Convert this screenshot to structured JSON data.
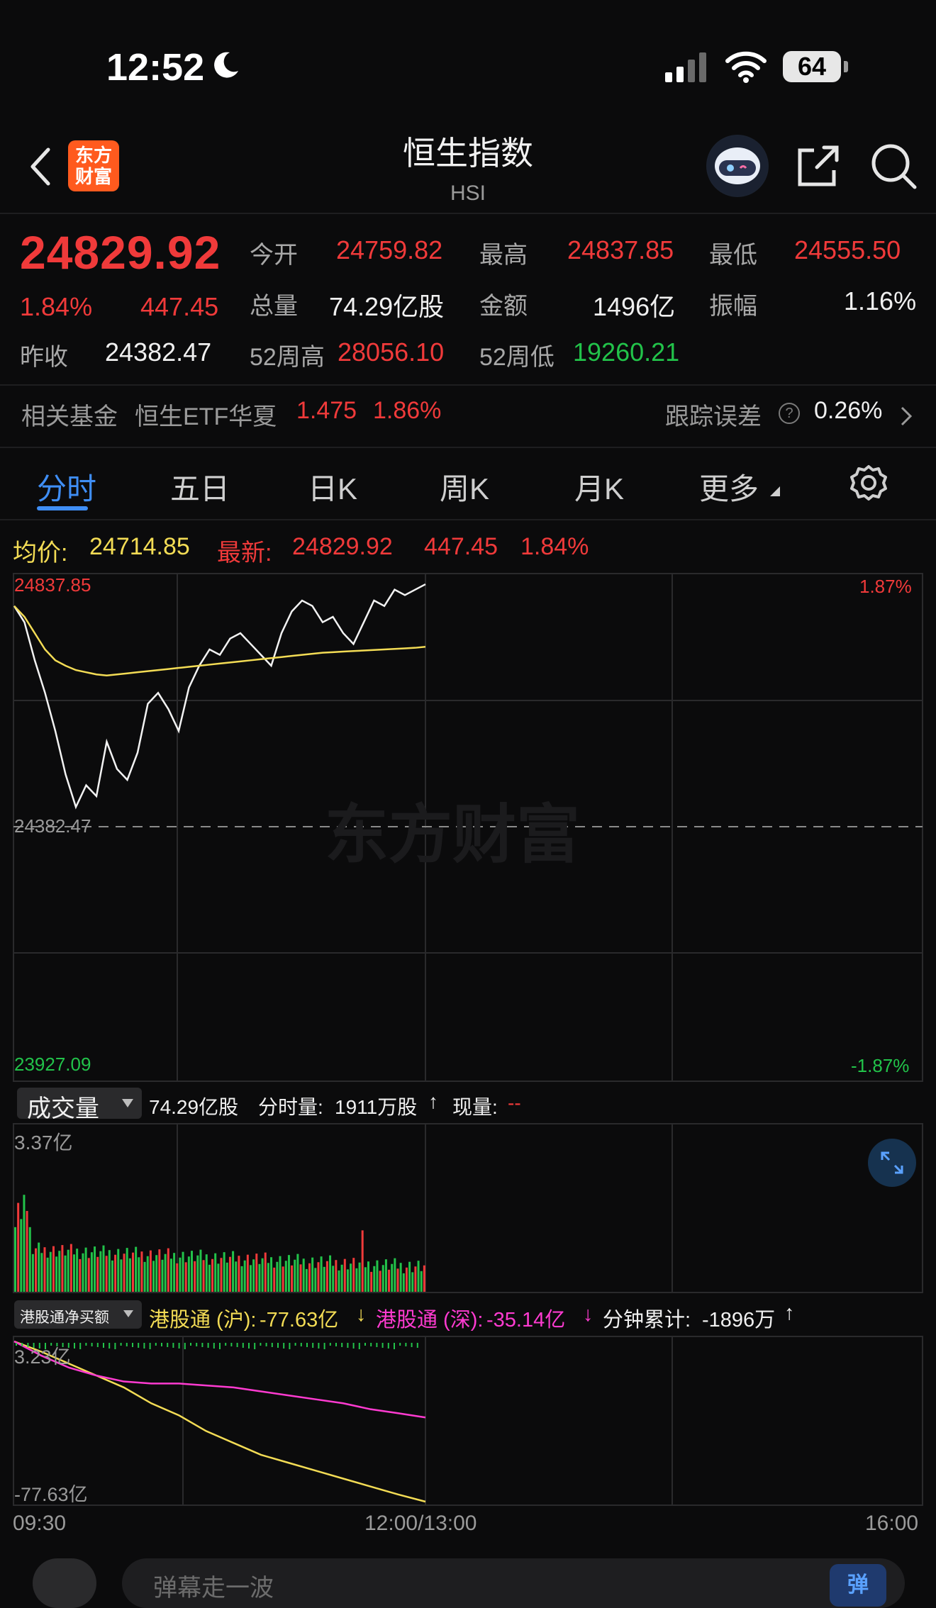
{
  "status_bar": {
    "time": "12:52",
    "battery": "64"
  },
  "header": {
    "title": "恒生指数",
    "subtitle": "HSI",
    "logo_text": "东方\n财富"
  },
  "quote": {
    "price": "24829.92",
    "change_pct": "1.84%",
    "change": "447.45",
    "prev_close_label": "昨收",
    "prev_close": "24382.47",
    "open_label": "今开",
    "open": "24759.82",
    "high_label": "最高",
    "high": "24837.85",
    "low_label": "最低",
    "low": "24555.50",
    "volume_label": "总量",
    "volume": "74.29亿股",
    "amount_label": "金额",
    "amount": "1496亿",
    "amplitude_label": "振幅",
    "amplitude": "1.16%",
    "wk52_high_label": "52周高",
    "wk52_high": "28056.10",
    "wk52_low_label": "52周低",
    "wk52_low": "19260.21"
  },
  "fund": {
    "label": "相关基金",
    "name": "恒生ETF华夏",
    "price": "1.475",
    "change_pct": "1.86%",
    "tracking_label": "跟踪误差",
    "help": "?",
    "tracking_value": "0.26%"
  },
  "tabs": [
    "分时",
    "五日",
    "日K",
    "周K",
    "月K",
    "更多"
  ],
  "chart_info": {
    "avg_label": "均价:",
    "avg_value": "24714.85",
    "latest_label": "最新:",
    "latest_value": "24829.92",
    "latest_change": "447.45",
    "latest_pct": "1.84%"
  },
  "chart_labels": {
    "top_left": "24837.85",
    "top_right": "1.87%",
    "mid_left": "24382.47",
    "bottom_left": "23927.09",
    "bottom_right": "-1.87%",
    "watermark": "东方财富"
  },
  "volume": {
    "selector": "成交量",
    "total": "74.29亿股",
    "tick_label": "分时量:",
    "tick_value": "1911万股",
    "tick_arrow": "↑",
    "now_label": "现量:",
    "now_value": "--",
    "max_label": "3.37亿"
  },
  "flow": {
    "selector": "港股通净买额",
    "sh_label": "港股通 (沪):",
    "sh_value": "-77.63亿",
    "sh_arrow": "↓",
    "sz_label": "港股通 (深):",
    "sz_value": "-35.14亿",
    "sz_arrow": "↓",
    "min_label": "分钟累计:",
    "min_value": "-1896万",
    "min_arrow": "↑",
    "top_label": "3.23亿",
    "bottom_label": "-77.63亿"
  },
  "time_axis": {
    "start": "09:30",
    "mid": "12:00/13:00",
    "end": "16:00"
  },
  "bottom_bar": {
    "placeholder": "弹幕走一波",
    "danmu_button": "弹"
  },
  "colors": {
    "up": "#f03a3a",
    "down": "#22c34a",
    "avg_line": "#f3dc55",
    "active_tab": "#3f8ef5",
    "flow_sz": "#ff3bd1"
  },
  "chart_data": {
    "type": "line",
    "series": [
      {
        "name": "最新",
        "values": [
          24790,
          24760,
          24690,
          24630,
          24560,
          24480,
          24420,
          24460,
          24440,
          24540,
          24490,
          24470,
          24520,
          24610,
          24630,
          24600,
          24560,
          24640,
          24680,
          24710,
          24700,
          24730,
          24740,
          24720,
          24700,
          24680,
          24740,
          24780,
          24800,
          24790,
          24760,
          24770,
          24740,
          24720,
          24760,
          24800,
          24790,
          24820,
          24810,
          24820,
          24829.92
        ]
      },
      {
        "name": "均价",
        "values": [
          24790,
          24770,
          24740,
          24710,
          24690,
          24680,
          24672,
          24668,
          24664,
          24662,
          24664,
          24666,
          24668,
          24670,
          24672,
          24674,
          24676,
          24678,
          24680,
          24682,
          24684,
          24686,
          24688,
          24690,
          24692,
          24694,
          24696,
          24698,
          24700,
          24702,
          24704,
          24705,
          24706,
          24707,
          24708,
          24709,
          24710,
          24711,
          24712,
          24713,
          24714.85
        ]
      }
    ],
    "xlabels": [
      "09:30",
      "12:00/13:00",
      "16:00"
    ],
    "ylim": [
      23927.09,
      24837.85
    ],
    "prev_close": 24382.47,
    "flow_series": [
      {
        "name": "港股通 (沪)",
        "values": [
          3.23,
          -2,
          -8,
          -14,
          -20,
          -28,
          -34,
          -42,
          -48,
          -54,
          -58,
          -62,
          -66,
          -70,
          -74,
          -77.63
        ]
      },
      {
        "name": "港股通 (深)",
        "values": [
          3.23,
          -4,
          -10,
          -14,
          -17,
          -18,
          -18,
          -19,
          -20,
          -22,
          -24,
          -26,
          -28,
          -31,
          -33,
          -35.14
        ]
      }
    ],
    "flow_ylim": [
      -77.63,
      3.23
    ]
  }
}
